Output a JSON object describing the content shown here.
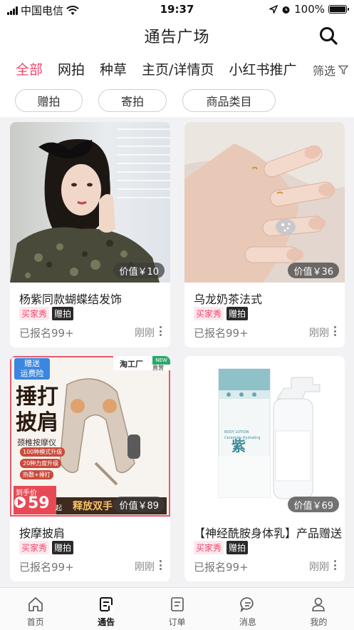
{
  "status_bar": {
    "carrier": "中国电信",
    "time": "19:37",
    "battery": "100%"
  },
  "header": {
    "title": "通告广场",
    "search_icon": "search-icon"
  },
  "tabs": [
    {
      "label": "全部",
      "active": true
    },
    {
      "label": "网拍",
      "active": false
    },
    {
      "label": "种草",
      "active": false
    },
    {
      "label": "主页/详情页",
      "active": false
    },
    {
      "label": "小红书推广",
      "active": false
    }
  ],
  "filter": {
    "label": "筛选",
    "icon": "filter-icon"
  },
  "chips": [
    {
      "label": "赠拍"
    },
    {
      "label": "寄拍"
    },
    {
      "label": "商品类目"
    }
  ],
  "cards": [
    {
      "title": "杨紫同款蝴蝶结发饰",
      "price": "价值￥10",
      "tag1": "买家秀",
      "tag2": "赠拍",
      "enrolled": "已报名99+",
      "time": "刚刚"
    },
    {
      "title": "乌龙奶茶法式",
      "price": "价值￥36",
      "tag1": "买家秀",
      "tag2": "赠拍",
      "enrolled": "已报名99+",
      "time": "刚刚"
    },
    {
      "title": "按摩披肩",
      "price": "价值￥89",
      "tag1": "买家秀",
      "tag2": "赠拍",
      "enrolled": "已报名99+",
      "time": "刚刚",
      "promo": {
        "line1": "赠送",
        "line2": "运费险",
        "big1": "捶打",
        "big2": "披肩",
        "sub": "颈椎按摩仪",
        "b1": "100种模式升级",
        "b2": "20种力度升级",
        "b3": "热敷+捶打",
        "to_hand": "到手价",
        "price": "59",
        "qi": "起",
        "slogan": "释放双手",
        "brand": "淘工厂",
        "brand2": "直营",
        "new": "NEW"
      }
    },
    {
      "title": "【神经酰胺身体乳】产品赠送",
      "price": "价值￥69",
      "tag1": "买家秀",
      "tag2": "赠拍",
      "enrolled": "已报名99+",
      "time": "刚刚",
      "product": {
        "logo": "紫",
        "line1": "BODY LOTION",
        "line2": "Ceramide Hydrating"
      }
    }
  ],
  "tabbar": [
    {
      "label": "首页",
      "icon": "home-icon",
      "active": false
    },
    {
      "label": "通告",
      "icon": "notice-icon",
      "active": true
    },
    {
      "label": "订单",
      "icon": "order-icon",
      "active": false
    },
    {
      "label": "消息",
      "icon": "message-icon",
      "active": false
    },
    {
      "label": "我的",
      "icon": "profile-icon",
      "active": false
    }
  ],
  "colors": {
    "accent": "#f2466c",
    "dark_tag": "#2a2a2a",
    "background": "#f2f2f4"
  }
}
